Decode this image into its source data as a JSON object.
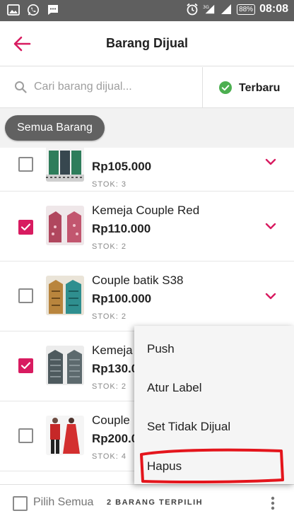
{
  "status_bar": {
    "signal_label": "3G",
    "battery": "88%",
    "time": "08:08"
  },
  "header": {
    "title": "Barang Dijual"
  },
  "search": {
    "placeholder": "Cari barang dijual...",
    "value": ""
  },
  "sort": {
    "label": "Terbaru"
  },
  "filter": {
    "chip_label": "Semua Barang"
  },
  "products": [
    {
      "name": "",
      "price": "Rp105.000",
      "stock": "STOK: 3",
      "checked": false
    },
    {
      "name": "Kemeja Couple Red",
      "price": "Rp110.000",
      "stock": "STOK: 2",
      "checked": true
    },
    {
      "name": "Couple batik S38",
      "price": "Rp100.000",
      "stock": "STOK: 2",
      "checked": false
    },
    {
      "name": "Kemeja",
      "price": "Rp130.0",
      "stock": "STOK: 2",
      "checked": true
    },
    {
      "name": "Couple",
      "price": "Rp200.0",
      "stock": "STOK: 4",
      "checked": false
    }
  ],
  "bottom_bar": {
    "select_all_label": "Pilih Semua",
    "selected_count_label": "2 BARANG TERPILIH"
  },
  "menu": {
    "items": [
      "Push",
      "Atur Label",
      "Set Tidak Dijual",
      "Hapus"
    ]
  },
  "colors": {
    "accent": "#d81b60",
    "check_green": "#4caf50",
    "highlight_ring": "#e4151c"
  }
}
